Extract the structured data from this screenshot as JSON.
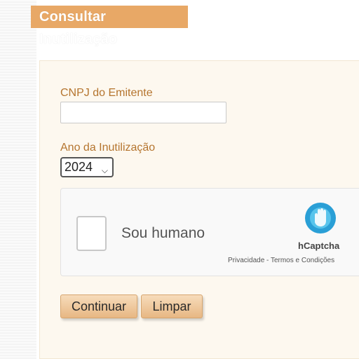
{
  "page": {
    "title": "Consultar Inutilização"
  },
  "form": {
    "cnpj_label": "CNPJ do Emitente",
    "cnpj_value": "",
    "ano_label": "Ano da Inutilização",
    "ano_selected": "2024"
  },
  "captcha": {
    "checkbox_label": "Sou humano",
    "brand": "hCaptcha",
    "links": "Privacidade - Termos e Condições"
  },
  "buttons": {
    "continuar": "Continuar",
    "limpar": "Limpar"
  },
  "colors": {
    "title_bar": "#e8a866",
    "label": "#b5752f",
    "panel": "#fdf8ef",
    "button_top": "#f7dcbb",
    "button_bottom": "#e7b783",
    "hcaptcha_blue": "#2a9fd6"
  },
  "icons": {
    "captcha_logo": "hcaptcha-hand-icon",
    "select_caret": "chevron-down-icon"
  }
}
